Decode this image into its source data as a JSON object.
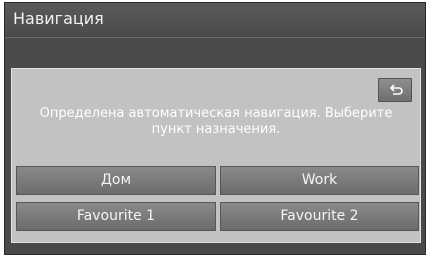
{
  "header": {
    "title": "Навигация"
  },
  "dialog": {
    "message": "Определена автоматическая навигация. Выберите пункт назначения.",
    "back_icon": "return-arrow-icon",
    "buttons": {
      "home": "Дом",
      "work": "Work",
      "favourite1": "Favourite 1",
      "favourite2": "Favourite 2"
    }
  }
}
